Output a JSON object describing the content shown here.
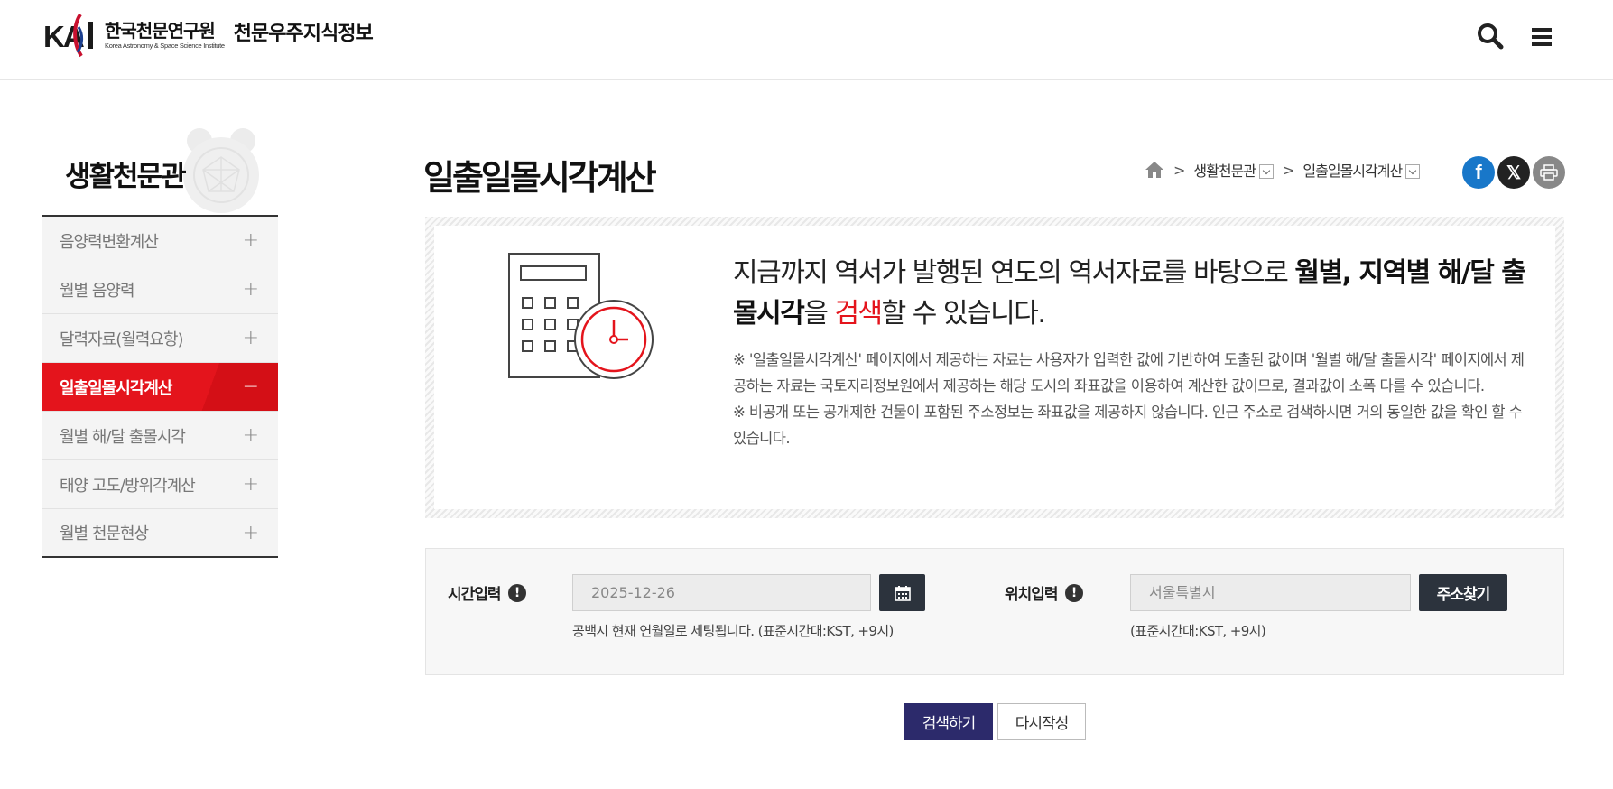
{
  "header": {
    "logo_mark": "KASI",
    "org_name_ko": "한국천문연구원",
    "org_name_en": "Korea Astronomy & Space Science Institute",
    "site_name": "천문우주지식정보",
    "icons": [
      "search-icon",
      "menu-icon"
    ]
  },
  "sidebar": {
    "title": "생활천문관",
    "items": [
      {
        "label": "음양력변환계산",
        "expander": "+"
      },
      {
        "label": "월별 음양력",
        "expander": "+"
      },
      {
        "label": "달력자료(월력요항)",
        "expander": "+"
      },
      {
        "label": "일출일몰시각계산",
        "expander": "−",
        "active": true
      },
      {
        "label": "월별 해/달 출몰시각",
        "expander": "+"
      },
      {
        "label": "태양 고도/방위각계산",
        "expander": "+"
      },
      {
        "label": "월별 천문현상",
        "expander": "+"
      }
    ]
  },
  "main": {
    "page_title": "일출일몰시각계산",
    "breadcrumb": [
      "생활천문관",
      "일출일몰시각계산"
    ],
    "share": [
      "facebook-icon",
      "x-icon",
      "print-icon"
    ],
    "info": {
      "lead_1": "지금까지 역서가 발행된 연도의 역서자료를 바탕으로 ",
      "lead_bold": "월별, 지역별 해/달 출몰시각",
      "lead_2": "을 ",
      "lead_red": "검색",
      "lead_3": "할 수 있습니다.",
      "note_1": "※ '일출일몰시각계산' 페이지에서 제공하는 자료는 사용자가 입력한 값에 기반하여 도출된 값이며 '월별 해/달 출몰시각' 페이지에서 제공하는 자료는 국토지리정보원에서 제공하는 해당 도시의 좌표값을 이용하여 계산한 값이므로, 결과값이 소폭 다를 수 있습니다.",
      "note_2": "※ 비공개 또는 공개제한 건물이 포함된 주소정보는 좌표값을 제공하지 않습니다. 인근 주소로 검색하시면 거의 동일한 값을 확인 할 수 있습니다."
    },
    "form": {
      "time_label": "시간입력",
      "time_value": "2025-12-26",
      "time_help": "공백시 현재 연월일로 세팅됩니다. (표준시간대:KST, +9시)",
      "loc_label": "위치입력",
      "loc_value": "서울특별시",
      "loc_button": "주소찾기",
      "loc_help": "(표준시간대:KST, +9시)"
    },
    "buttons": {
      "search": "검색하기",
      "reset": "다시작성"
    }
  },
  "colors": {
    "accent_red": "#e4141c",
    "dark_button": "#2c333d",
    "search_button": "#2c2a6b"
  }
}
